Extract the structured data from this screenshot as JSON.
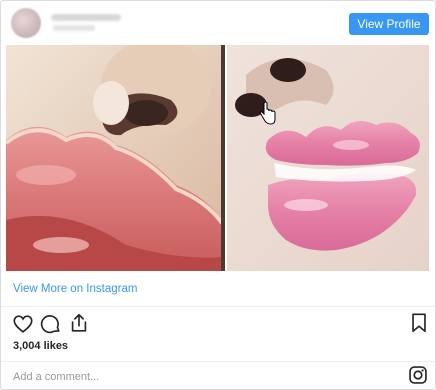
{
  "post": {
    "view_profile_label": "View Profile",
    "view_more_label": "View More on Instagram",
    "likes_text": "3,004 likes",
    "comment_placeholder": "Add a comment..."
  },
  "icons": {
    "like": "heart-icon",
    "comment": "comment-icon",
    "share": "share-icon",
    "save": "bookmark-icon",
    "brand": "instagram-icon"
  },
  "colors": {
    "accent": "#3897f0",
    "text": "#262626",
    "muted": "#999999",
    "border": "#dbdbdb"
  }
}
